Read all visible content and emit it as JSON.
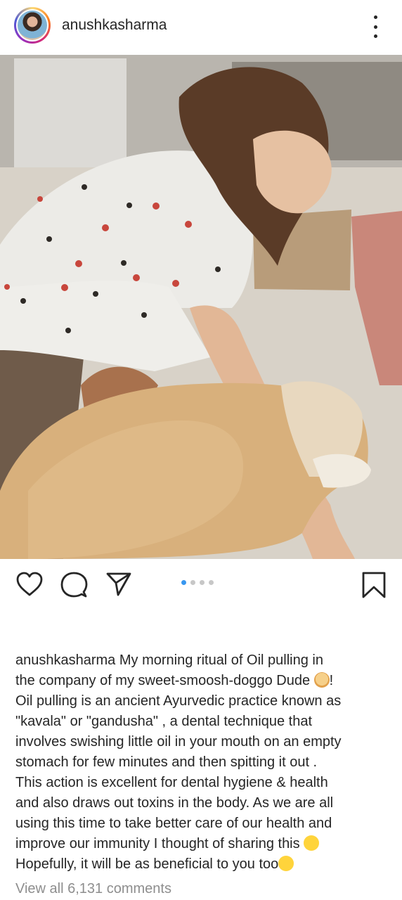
{
  "post": {
    "username": "anushkasharma",
    "photo": {
      "carousel_total": 4,
      "carousel_active": 1
    }
  },
  "icons": {
    "more": "more-vertical-icon",
    "like": "heart-icon",
    "comment": "comment-bubble-icon",
    "share": "send-icon",
    "save": "bookmark-icon"
  },
  "caption": {
    "username": "anushkasharma",
    "lines": [
      "My morning ritual of Oil pulling in",
      "the company of my sweet-smoosh-doggo Dude",
      "!",
      "Oil pulling is an ancient Ayurvedic practice known as",
      "\"kavala\" or \"gandusha\" , a dental technique that",
      "involves swishing little oil in your mouth on an empty",
      "stomach for few minutes and then spitting it out .",
      "This action is excellent for dental hygiene & health",
      "and also draws out toxins in the body. As we are all",
      "using this time to take better care of our health and",
      "improve our immunity I thought of sharing this",
      "Hopefully, it will be as beneficial to you too"
    ]
  },
  "comments": {
    "view_all_label": "View all 6,131 comments"
  },
  "colors": {
    "text": "#262626",
    "muted": "#8e8e8e",
    "carousel_active": "#3897f0",
    "carousel_inactive": "#c7c7c7"
  }
}
